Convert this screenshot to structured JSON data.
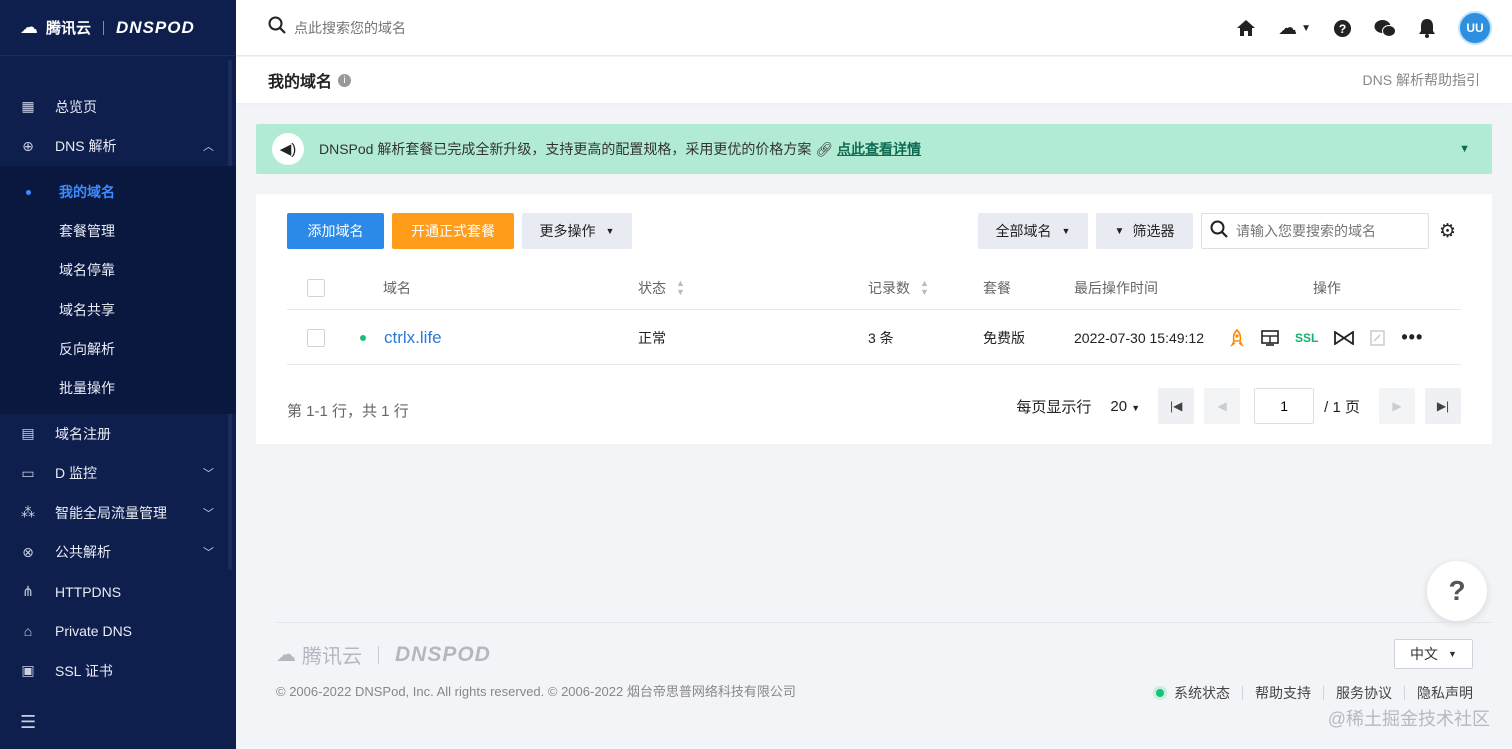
{
  "sidebar": {
    "logo_brand": "腾讯云",
    "logo_product": "DNSPOD",
    "menu": [
      {
        "label": "总览页",
        "icon": "dashboard-icon"
      },
      {
        "label": "DNS 解析",
        "icon": "globe-icon",
        "expanded": true
      },
      {
        "label": "域名注册",
        "icon": "calendar-icon"
      },
      {
        "label": "D 监控",
        "icon": "monitor-icon"
      },
      {
        "label": "智能全局流量管理",
        "icon": "network-icon"
      },
      {
        "label": "公共解析",
        "icon": "public-dns-icon"
      },
      {
        "label": "HTTPDNS",
        "icon": "httpdns-icon"
      },
      {
        "label": "Private DNS",
        "icon": "private-dns-icon"
      },
      {
        "label": "SSL 证书",
        "icon": "certificate-icon"
      }
    ],
    "submenu": [
      {
        "label": "我的域名",
        "active": true
      },
      {
        "label": "套餐管理"
      },
      {
        "label": "域名停靠"
      },
      {
        "label": "域名共享"
      },
      {
        "label": "反向解析"
      },
      {
        "label": "批量操作"
      }
    ]
  },
  "topbar": {
    "search_placeholder": "点此搜索您的域名",
    "avatar_text": "UU"
  },
  "page": {
    "title": "我的域名",
    "help_link": "DNS 解析帮助指引"
  },
  "notice": {
    "text": "DNSPod 解析套餐已完成全新升级，支持更高的配置规格，采用更优的价格方案",
    "link": "点此查看详情"
  },
  "toolbar": {
    "add_domain": "添加域名",
    "open_plan": "开通正式套餐",
    "more_actions": "更多操作",
    "all_domains": "全部域名",
    "filter": "筛选器",
    "search_placeholder": "请输入您要搜索的域名"
  },
  "table": {
    "columns": {
      "domain": "域名",
      "status": "状态",
      "records": "记录数",
      "plan": "套餐",
      "last_modified": "最后操作时间",
      "actions": "操作"
    },
    "rows": [
      {
        "domain": "ctrlx.life",
        "status": "正常",
        "records": "3 条",
        "plan": "免费版",
        "last_modified": "2022-07-30 15:49:12",
        "ssl_label": "SSL"
      }
    ]
  },
  "pagination": {
    "summary": "第 1-1 行，共 1 行",
    "per_page_label": "每页显示行",
    "per_page": "20",
    "current_page": "1",
    "total_pages": "/ 1 页"
  },
  "footer": {
    "brand": "腾讯云",
    "product": "DNSPOD",
    "copyright": "© 2006-2022 DNSPod, Inc. All rights reserved. © 2006-2022 烟台帝思普网络科技有限公司",
    "language": "中文",
    "links": [
      "系统状态",
      "帮助支持",
      "服务协议",
      "隐私声明"
    ],
    "watermark": "@稀土掘金技术社区"
  },
  "colors": {
    "sidebar_bg": "#0f1f4d",
    "primary": "#2b8ae8",
    "orange": "#ff9c19",
    "notice_bg": "#b2ebd4",
    "status_green": "#1bbf7a",
    "link_blue": "#2b7ad8"
  }
}
